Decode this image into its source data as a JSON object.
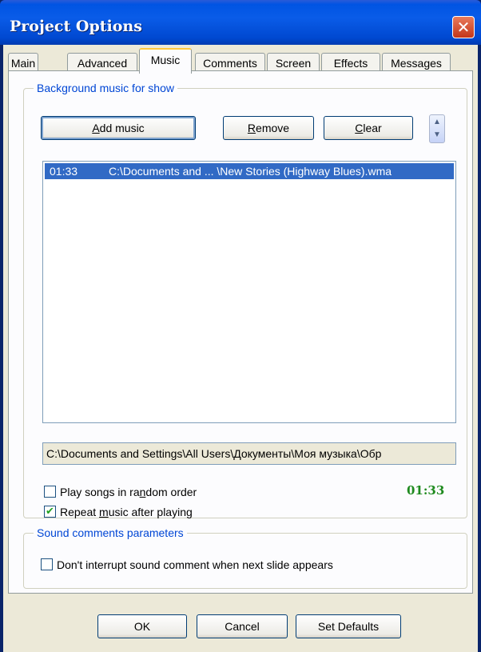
{
  "window": {
    "title": "Project Options",
    "close_glyph": "✕"
  },
  "tabs": [
    {
      "label": "Main"
    },
    {
      "label": "Advanced"
    },
    {
      "label": "Music",
      "active": true
    },
    {
      "label": "Comments"
    },
    {
      "label": "Screen"
    },
    {
      "label": "Effects"
    },
    {
      "label": "Messages"
    }
  ],
  "music_group": {
    "label": "Background music for show",
    "buttons": {
      "add_music": {
        "pre": "",
        "key": "A",
        "post": "dd music"
      },
      "remove": {
        "pre": "",
        "key": "R",
        "post": "emove"
      },
      "clear": {
        "pre": "",
        "key": "C",
        "post": "lear"
      }
    },
    "reorder_icons": [
      "arrow-up-icon",
      "arrow-down-icon"
    ],
    "playlist": [
      {
        "duration": "01:33",
        "path": "C:\\Documents and ... \\New Stories (Highway Blues).wma",
        "selected": true
      }
    ],
    "selected_path": "C:\\Documents and Settings\\All Users\\Документы\\Моя музыка\\Обр",
    "random_order": {
      "pre": "Play songs in ra",
      "key": "n",
      "post": "dom order",
      "checked": false
    },
    "repeat": {
      "pre": "Repeat ",
      "key": "m",
      "post": "usic after playing",
      "checked": true
    },
    "total_duration": "01:33"
  },
  "sound_group": {
    "label": "Sound comments parameters",
    "dont_interrupt": {
      "label": "Don't interrupt sound comment when next slide appears",
      "checked": false
    }
  },
  "footer": {
    "ok": "OK",
    "cancel": "Cancel",
    "set_defaults": "Set Defaults"
  },
  "colors": {
    "title_blue": "#0054e3",
    "accent_orange": "#ffc83c",
    "selection": "#316ac5",
    "duration_green": "#1e8a1e",
    "group_label": "#0046d5"
  },
  "checkmark_glyph": "✔",
  "spin_up": "▲",
  "spin_down": "▼"
}
